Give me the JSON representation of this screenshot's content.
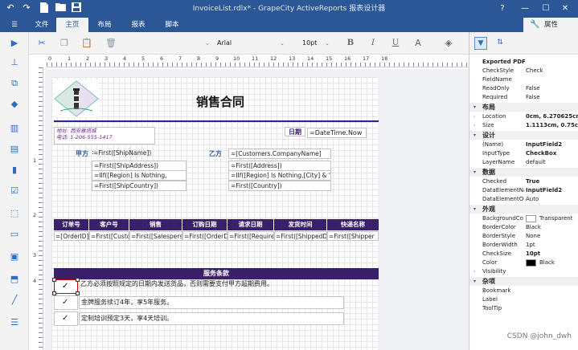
{
  "titlebar": {
    "title": "InvoiceList.rdlx* - GrapeCity ActiveReports 报表设计器",
    "icons": [
      "undo-icon",
      "redo-icon",
      "new-file-icon",
      "open-folder-icon",
      "save-icon"
    ],
    "help": "?",
    "minimize": "—",
    "maximize": "☐",
    "close": "✕"
  },
  "ribbon": {
    "menu_icon": "☰",
    "tabs": [
      {
        "label": "文件",
        "active": false
      },
      {
        "label": "主页",
        "active": true
      },
      {
        "label": "布局",
        "active": false
      },
      {
        "label": "报表",
        "active": false
      },
      {
        "label": "脚本",
        "active": false
      }
    ],
    "properties_tab": "属性"
  },
  "toolbar": {
    "font_name": "Arial",
    "font_size": "10pt",
    "bold": "B",
    "italic": "I",
    "underline": "U"
  },
  "rulers": {
    "h_numbers": [
      "0",
      "1",
      "2",
      "3",
      "4",
      "5",
      "6",
      "7",
      "8",
      "9",
      "10",
      "11",
      "12",
      "13",
      "14",
      "15",
      "16",
      "17",
      "18"
    ],
    "v_numbers": [
      "1",
      "2",
      "3",
      "4"
    ]
  },
  "report": {
    "title": "销售合同",
    "address_line1": "地址: 西安雁塔城",
    "address_line2": "电话: 1-206-555-1417",
    "date_label": "日期",
    "date_value": "=DateTime.Now",
    "party_a_label": "甲方",
    "party_b_label": "乙方",
    "party_a_fields": [
      "=First([ShipName])",
      "=First([ShipAddress])",
      "=IIf([Region] Is Nothing,",
      "=First([ShipCountry])"
    ],
    "party_b_fields": [
      "=[Customers.CompanyName]",
      "=First([Address])",
      "=IIf([Region] Is Nothing,[City] & \"",
      "=First([Country])"
    ],
    "table_headers": [
      "订单号",
      "客户号",
      "销售",
      "订购日期",
      "请求日期",
      "发货时间",
      "快递名称"
    ],
    "table_cells": [
      "=[OrderID]",
      "=First([Custo",
      "=First([Salespers",
      "=First([OrderD",
      "=First([Require",
      "=First([ShippedD",
      "=First([Shipper"
    ],
    "terms_header": "服务条款",
    "terms": [
      {
        "check": "✓",
        "text": "乙方必须按照规定的日期内发送货品，否则需要支付甲方超期费用。"
      },
      {
        "check": "✓",
        "text": "金牌服务续订4年，享5年服务。"
      },
      {
        "check": "✓",
        "text": "定制培训预定3天，享4天培训。"
      }
    ]
  },
  "properties": {
    "exported_pdf_label": "Exported PDF",
    "top_rows": [
      {
        "name": "CheckStyle",
        "value": "Check"
      },
      {
        "name": "FieldName",
        "value": ""
      },
      {
        "name": "ReadOnly",
        "value": "False"
      },
      {
        "name": "Required",
        "value": "False"
      }
    ],
    "categories": {
      "layout": "布局",
      "design": "设计",
      "data": "数据",
      "appearance": "外观",
      "misc": "杂项"
    },
    "layout_rows": [
      {
        "name": "Location",
        "value": "0cm, 6.270625cm"
      },
      {
        "name": "Size",
        "value": "1.1113cm, 0.75cm"
      }
    ],
    "design_rows": [
      {
        "name": "(Name)",
        "value": "InputField2"
      },
      {
        "name": "InputType",
        "value": "CheckBox"
      },
      {
        "name": "LayerName",
        "value": "default"
      }
    ],
    "data_rows": [
      {
        "name": "Checked",
        "value": "True"
      },
      {
        "name": "DataElementNa",
        "value": "InputField2"
      },
      {
        "name": "DataElementOu",
        "value": "Auto"
      }
    ],
    "appearance_rows": [
      {
        "name": "BackgroundCo",
        "value": "Transparent"
      },
      {
        "name": "BorderColor",
        "value": "Black"
      },
      {
        "name": "BorderStyle",
        "value": "None"
      },
      {
        "name": "BorderWidth",
        "value": "1pt"
      },
      {
        "name": "CheckSize",
        "value": "10pt"
      },
      {
        "name": "Color",
        "value": "Black"
      },
      {
        "name": "Visibility",
        "value": ""
      }
    ],
    "misc_rows": [
      {
        "name": "Bookmark",
        "value": ""
      },
      {
        "name": "Label",
        "value": ""
      },
      {
        "name": "ToolTip",
        "value": ""
      }
    ]
  },
  "watermark": "CSDN @john_dwh",
  "colors": {
    "titlebar": "#2b5797",
    "table_header": "#3a1f6b",
    "title_rule": "#2a2a8a",
    "selection": "#d00000"
  }
}
